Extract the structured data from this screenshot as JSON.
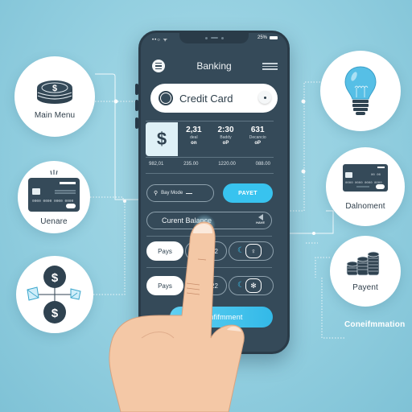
{
  "phone": {
    "status": {
      "signal": "••○ ᯤ",
      "battery_text": "25%"
    },
    "header": {
      "title": "Banking"
    },
    "card_selector": {
      "label": "Credit Card"
    },
    "summary": {
      "currency_symbol": "$",
      "stats": [
        {
          "value": "2,31",
          "label": "deal",
          "sub": "on"
        },
        {
          "value": "2:30",
          "label": "Baddy",
          "sub": "oP"
        },
        {
          "value": "631",
          "label": "Decancio",
          "sub": "oP"
        }
      ],
      "amounts": [
        "982,01",
        "235.00",
        "1220.00",
        "088.00"
      ]
    },
    "pay_mode": {
      "icon": "pin-icon",
      "label": "Bay Mode"
    },
    "payet_button": "PAYET",
    "balance": {
      "label": "Curent Balance",
      "side_label": "HAVE"
    },
    "pay_rows": [
      {
        "label": "Pays",
        "amount": "2.02",
        "icon": "person-icon"
      },
      {
        "label": "Pays",
        "amount": "2.22",
        "icon": "sparkle-icon"
      }
    ],
    "confirm_button": "Confifmment"
  },
  "bubbles": {
    "main_menu": {
      "label": "Main Menu"
    },
    "card": {
      "label": "Uenare",
      "card_number": "0000 0000 0000 0000"
    },
    "transfer": {
      "label": ""
    },
    "bulb": {
      "label": ""
    },
    "debit": {
      "label": "Dalnoment",
      "card_number": "0000 0000 0000 0000"
    },
    "coins": {
      "label": "Payent"
    },
    "confirmation": {
      "label": "Coneifmmation"
    }
  },
  "colors": {
    "accent": "#38c3ef",
    "phone_body": "#354a59",
    "background": "#93cfe0"
  }
}
